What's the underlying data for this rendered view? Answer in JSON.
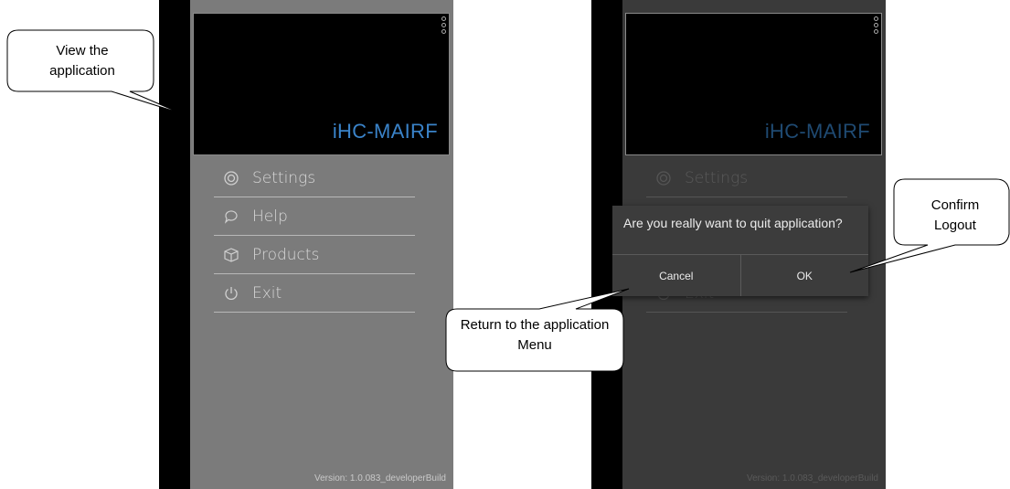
{
  "left_screen": {
    "app_title": "iHC-MAIRF",
    "menu": [
      {
        "icon": "settings-icon",
        "label": "Settings"
      },
      {
        "icon": "help-icon",
        "label": "Help"
      },
      {
        "icon": "products-icon",
        "label": "Products"
      },
      {
        "icon": "power-icon",
        "label": "Exit"
      }
    ],
    "version": "Version: 1.0.083_developerBuild"
  },
  "right_screen": {
    "app_title": "iHC-MAIRF",
    "menu": [
      {
        "icon": "settings-icon",
        "label": "Settings"
      },
      {
        "icon": "help-icon",
        "label": ""
      },
      {
        "icon": "products-icon",
        "label": ""
      },
      {
        "icon": "power-icon",
        "label": "Exit"
      }
    ],
    "version": "Version: 1.0.083_developerBuild",
    "dialog": {
      "message": "Are you really want to quit application?",
      "cancel": "Cancel",
      "ok": "OK"
    }
  },
  "callouts": {
    "view": "View the application",
    "confirm": "Confirm Logout",
    "return": "Return to the application Menu"
  },
  "colors": {
    "title_blue": "#3a83c9",
    "screen_gray": "#7b7b7b",
    "dialog_bg": "#3c3c3c"
  }
}
